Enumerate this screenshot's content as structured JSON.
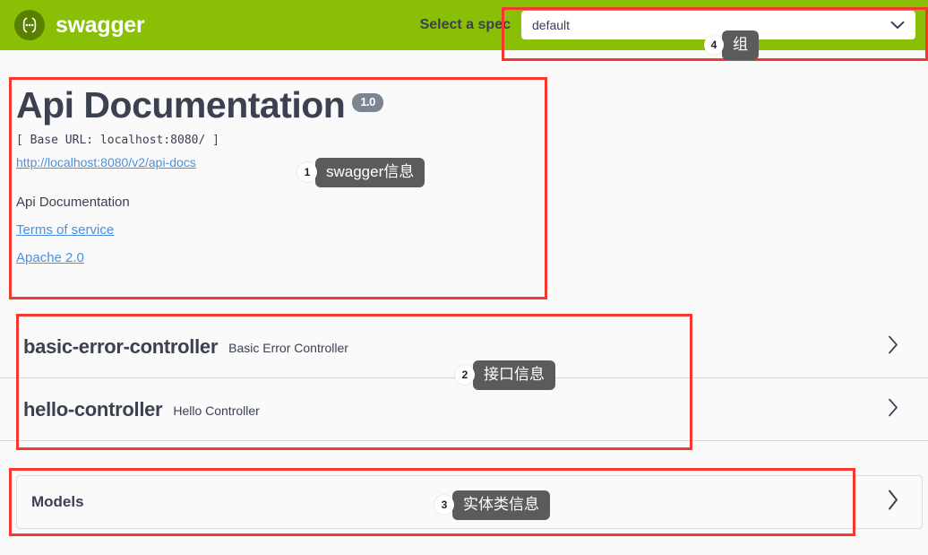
{
  "topbar": {
    "brand": "swagger",
    "logo_icon": "swagger-braces-icon",
    "spec_label": "Select a spec",
    "spec_value": "default",
    "chevron_icon": "chevron-down-icon",
    "bg_color": "#89bf04"
  },
  "info": {
    "title": "Api Documentation",
    "version": "1.0",
    "base_url": "[ Base URL: localhost:8080/ ]",
    "api_docs_url": "http://localhost:8080/v2/api-docs",
    "description": "Api Documentation",
    "terms_link": "Terms of service",
    "license_link": "Apache 2.0"
  },
  "tags": [
    {
      "name": "basic-error-controller",
      "description": "Basic Error Controller",
      "arrow_icon": "chevron-right-icon"
    },
    {
      "name": "hello-controller",
      "description": "Hello Controller",
      "arrow_icon": "chevron-right-icon"
    }
  ],
  "models": {
    "title": "Models",
    "arrow_icon": "chevron-right-icon"
  },
  "callouts": [
    {
      "number": "1",
      "text": "swagger信息"
    },
    {
      "number": "2",
      "text": "接口信息"
    },
    {
      "number": "3",
      "text": "实体类信息"
    },
    {
      "number": "4",
      "text": "组"
    }
  ],
  "annotation_color": "#f4372f"
}
